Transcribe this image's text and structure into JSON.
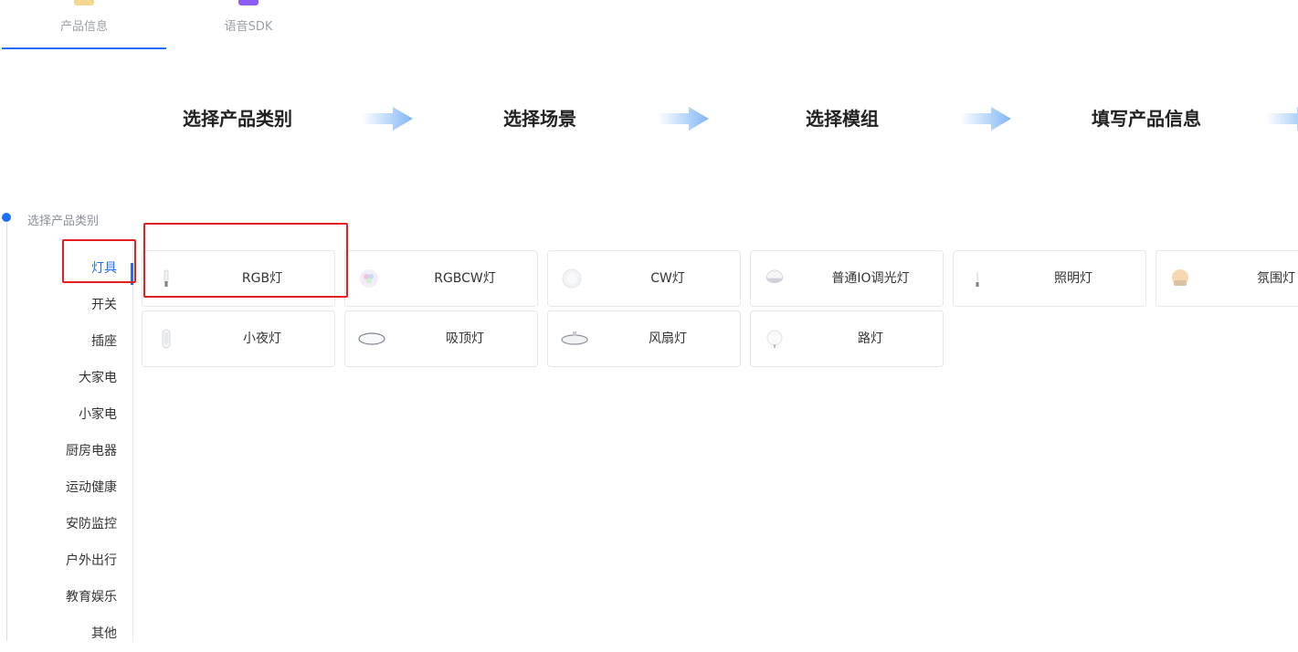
{
  "top_tabs": [
    {
      "label": "产品信息",
      "icon": "box-icon"
    },
    {
      "label": "语音SDK",
      "icon": "sdk-cube-icon"
    }
  ],
  "steps": [
    {
      "label": "选择产品类别"
    },
    {
      "label": "选择场景"
    },
    {
      "label": "选择模组"
    },
    {
      "label": "填写产品信息"
    }
  ],
  "category_nav": {
    "title": "选择产品类别",
    "items": [
      {
        "label": "灯具",
        "active": true
      },
      {
        "label": "开关"
      },
      {
        "label": "插座"
      },
      {
        "label": "大家电"
      },
      {
        "label": "小家电"
      },
      {
        "label": "厨房电器"
      },
      {
        "label": "运动健康"
      },
      {
        "label": "安防监控"
      },
      {
        "label": "户外出行"
      },
      {
        "label": "教育娱乐"
      },
      {
        "label": "其他"
      }
    ]
  },
  "products": [
    {
      "label": "RGB灯",
      "icon": "bulb-icon"
    },
    {
      "label": "RGBCW灯",
      "icon": "rgb-bulb-icon"
    },
    {
      "label": "CW灯",
      "icon": "cw-bulb-icon"
    },
    {
      "label": "普通IO调光灯",
      "icon": "ceiling-bulb-icon"
    },
    {
      "label": "照明灯",
      "icon": "lamp-icon"
    },
    {
      "label": "氛围灯",
      "icon": "ambient-lamp-icon"
    },
    {
      "label": "小夜灯",
      "icon": "night-light-icon"
    },
    {
      "label": "吸顶灯",
      "icon": "ceiling-light-icon"
    },
    {
      "label": "风扇灯",
      "icon": "fan-light-icon"
    },
    {
      "label": "路灯",
      "icon": "street-light-icon"
    }
  ],
  "colors": {
    "accent": "#1f6fff",
    "highlight_box": "#e62020",
    "card_border": "#e4e7ec"
  }
}
